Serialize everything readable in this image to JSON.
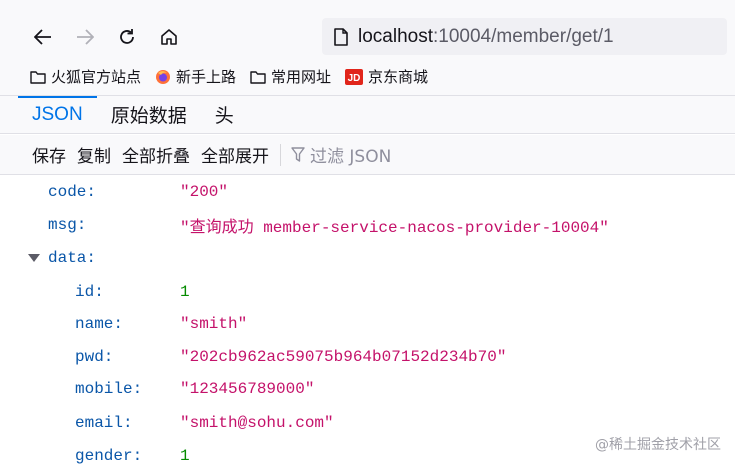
{
  "url": {
    "host": "localhost",
    "rest": ":10004/member/get/1"
  },
  "bookmarks": [
    {
      "label": "火狐官方站点",
      "icon": "folder-icon"
    },
    {
      "label": "新手上路",
      "icon": "firefox-icon"
    },
    {
      "label": "常用网址",
      "icon": "folder-icon"
    },
    {
      "label": "京东商城",
      "icon": "jd-icon"
    }
  ],
  "tabs": {
    "json": "JSON",
    "raw": "原始数据",
    "headers": "头"
  },
  "toolbar": {
    "save": "保存",
    "copy": "复制",
    "collapse_all": "全部折叠",
    "expand_all": "全部展开",
    "filter_placeholder": "过滤 JSON"
  },
  "json": {
    "code": {
      "key": "code:",
      "value": "\"200\""
    },
    "msg": {
      "key": "msg:",
      "value": "\"查询成功 member-service-nacos-provider-10004\""
    },
    "data": {
      "key": "data:",
      "fields": [
        {
          "key": "id:",
          "value": "1",
          "kind": "number"
        },
        {
          "key": "name:",
          "value": "\"smith\"",
          "kind": "string"
        },
        {
          "key": "pwd:",
          "value": "\"202cb962ac59075b964b07152d234b70\"",
          "kind": "string"
        },
        {
          "key": "mobile:",
          "value": "\"123456789000\"",
          "kind": "string"
        },
        {
          "key": "email:",
          "value": "\"smith@sohu.com\"",
          "kind": "string"
        },
        {
          "key": "gender:",
          "value": "1",
          "kind": "number"
        }
      ]
    }
  },
  "watermark": "@稀土掘金技术社区"
}
